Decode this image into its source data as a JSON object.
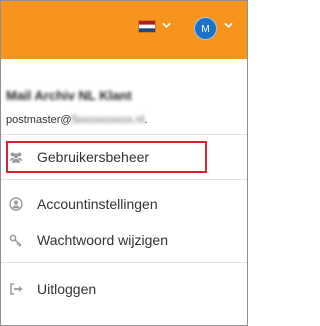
{
  "header": {
    "language_flag": "flag-netherlands-icon",
    "avatar_initial": "M",
    "colors": {
      "topbar": "#f7941d",
      "avatar": "#1a73c8"
    }
  },
  "account": {
    "name": "Mail Archiv NL Klant",
    "email_visible": "postmaster@",
    "email_hidden": "5xxxxxxxxxx.nl",
    "email_end": "."
  },
  "menu": {
    "items": [
      {
        "label": "Gebruikersbeheer",
        "icon": "users-icon"
      },
      {
        "label": "Accountinstellingen",
        "icon": "user-circle-icon"
      },
      {
        "label": "Wachtwoord wijzigen",
        "icon": "key-icon"
      },
      {
        "label": "Uitloggen",
        "icon": "sign-out-icon"
      }
    ],
    "highlight_color": "#d9232e"
  }
}
